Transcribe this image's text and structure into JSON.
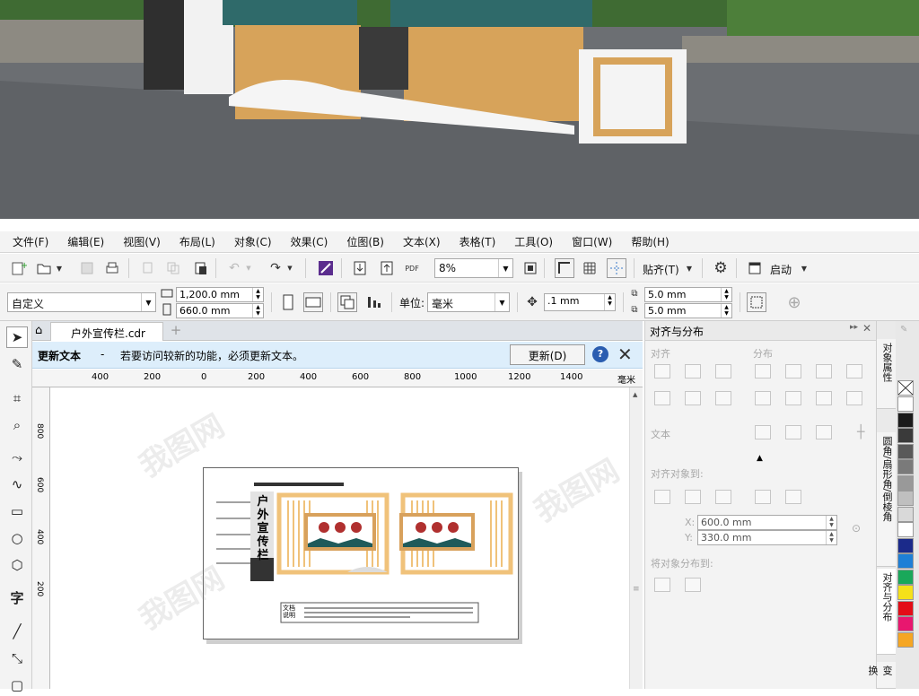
{
  "render_scene": {
    "description_text": ""
  },
  "menu": [
    "文件(F)",
    "编辑(E)",
    "视图(V)",
    "布局(L)",
    "对象(C)",
    "效果(C)",
    "位图(B)",
    "文本(X)",
    "表格(T)",
    "工具(O)",
    "窗口(W)",
    "帮助(H)"
  ],
  "toolbar": {
    "zoom_value": "8%",
    "snap_label": "贴齐(T)",
    "launch_label": "启动",
    "pdf_label": "PDF"
  },
  "propbar": {
    "preset": "自定义",
    "width": "1,200.0 mm",
    "height": "660.0 mm",
    "unit_label": "单位:",
    "unit_value": "毫米",
    "nudge": ".1 mm",
    "dup_x": "5.0 mm",
    "dup_y": "5.0 mm"
  },
  "document": {
    "tab_name": "户外宣传栏.cdr"
  },
  "infobar": {
    "title": "更新文本",
    "dash": "-",
    "message": "若要访问较新的功能，必须更新文本。",
    "button": "更新(D)",
    "help": "?"
  },
  "ruler": {
    "h_ticks": [
      "400",
      "200",
      "0",
      "200",
      "400",
      "600",
      "800",
      "1000",
      "1200",
      "1400"
    ],
    "unit": "毫米",
    "v_ticks": [
      "800",
      "600",
      "400",
      "200"
    ]
  },
  "artwork": {
    "title_chars": [
      "户",
      "外",
      "宣",
      "传",
      "栏"
    ],
    "note_label": "文档说明"
  },
  "panel": {
    "title": "对齐与分布",
    "align_section": "对齐",
    "distribute_section": "分布",
    "text_section": "文本",
    "align_to_section": "对齐对象到:",
    "x_value": "600.0 mm",
    "y_value": "330.0 mm",
    "x_label": "X:",
    "y_label": "Y:",
    "distribute_to_section": "将对象分布到:"
  },
  "vtabs": [
    "对象属性",
    "圆角/扇形角/倒棱角",
    "对齐与分布",
    "变换"
  ],
  "palette_colors": [
    "#ffffff",
    "#1a1a1a",
    "#3a3a3a",
    "#595959",
    "#7a7a7a",
    "#999999",
    "#bfbfbf",
    "#d9d9d9",
    "#ffffff",
    "#1b2a8a",
    "#1e7fd6",
    "#19a85a",
    "#f5e11a",
    "#e30d17",
    "#e8176f",
    "#f5a623"
  ]
}
